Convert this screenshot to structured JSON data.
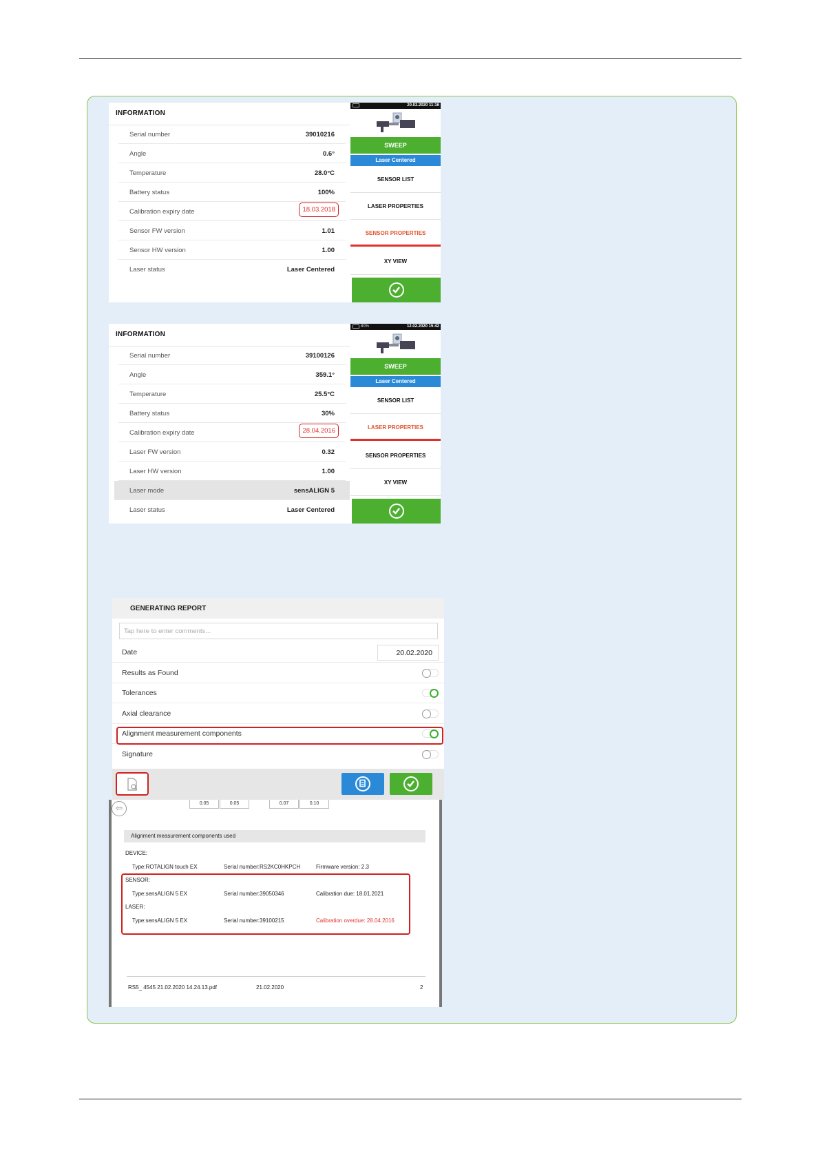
{
  "screen1": {
    "title": "INFORMATION",
    "rows": [
      {
        "label": "Serial number",
        "value": "39010216"
      },
      {
        "label": "Angle",
        "value": "0.6°"
      },
      {
        "label": "Temperature",
        "value": "28.0°C"
      },
      {
        "label": "Battery status",
        "value": "100%"
      },
      {
        "label": "Calibration expiry date",
        "value": "18.03.2018"
      },
      {
        "label": "Sensor FW version",
        "value": "1.01"
      },
      {
        "label": "Sensor HW version",
        "value": "1.00"
      },
      {
        "label": "Laser status",
        "value": "Laser Centered"
      }
    ],
    "menu": {
      "time": "20.02.2020 11:16",
      "sweep": "SWEEP",
      "laser_centered": "Laser Centered",
      "items": [
        "SENSOR LIST",
        "LASER PROPERTIES",
        "SENSOR PROPERTIES",
        "XY VIEW"
      ],
      "active_item": "SENSOR PROPERTIES"
    }
  },
  "screen2": {
    "title": "INFORMATION",
    "rows": [
      {
        "label": "Serial number",
        "value": "39100126"
      },
      {
        "label": "Angle",
        "value": "359.1°"
      },
      {
        "label": "Temperature",
        "value": "25.5°C"
      },
      {
        "label": "Battery status",
        "value": "30%"
      },
      {
        "label": "Calibration expiry date",
        "value": "28.04.2016"
      },
      {
        "label": "Laser FW version",
        "value": "0.32"
      },
      {
        "label": "Laser HW version",
        "value": "1.00"
      },
      {
        "label": "Laser mode",
        "value": "sensALIGN 5"
      },
      {
        "label": "Laser status",
        "value": "Laser Centered"
      }
    ],
    "menu": {
      "battery": "80%",
      "time": "12.02.2020 15:42",
      "sweep": "SWEEP",
      "laser_centered": "Laser Centered",
      "items": [
        "SENSOR LIST",
        "LASER PROPERTIES",
        "SENSOR PROPERTIES",
        "XY VIEW"
      ],
      "active_item": "LASER PROPERTIES"
    }
  },
  "report": {
    "title": "GENERATING REPORT",
    "comment_placeholder": "Tap here to enter comments...",
    "date_label": "Date",
    "date_value": "20.02.2020",
    "toggles": [
      {
        "label": "Results as Found",
        "on": false
      },
      {
        "label": "Tolerances",
        "on": true
      },
      {
        "label": "Axial clearance",
        "on": false
      },
      {
        "label": "Alignment measurement components",
        "on": true
      },
      {
        "label": "Signature",
        "on": false
      }
    ]
  },
  "pdf": {
    "table_values": [
      "0.05",
      "0.05",
      "0.07",
      "0.10"
    ],
    "section_title": "Alignment measurement components used",
    "device_label": "DEVICE:",
    "device": {
      "type": "Type:ROTALIGN touch EX",
      "serial": "Serial number:RS2KC0HKPCH",
      "extra": "Firmware version: 2.3"
    },
    "sensor_label": "SENSOR:",
    "sensor": {
      "type": "Type:sensALIGN 5 EX",
      "serial": "Serial number:39050346",
      "extra": "Calibration due: 18.01.2021"
    },
    "laser_label": "LASER:",
    "laser": {
      "type": "Type:sensALIGN 5 EX",
      "serial": "Serial number:39100215",
      "extra": "Calibration overdue: 28.04.2016"
    },
    "footer_file": "RS5_ 4545 21.02.2020 14.24.13.pdf",
    "footer_date": "21.02.2020",
    "footer_page": "2"
  },
  "colors": {
    "accent_green": "#4caf30",
    "accent_blue": "#2a8ad8",
    "alert_red": "#d02020",
    "panel_bg": "#e3eef8"
  }
}
